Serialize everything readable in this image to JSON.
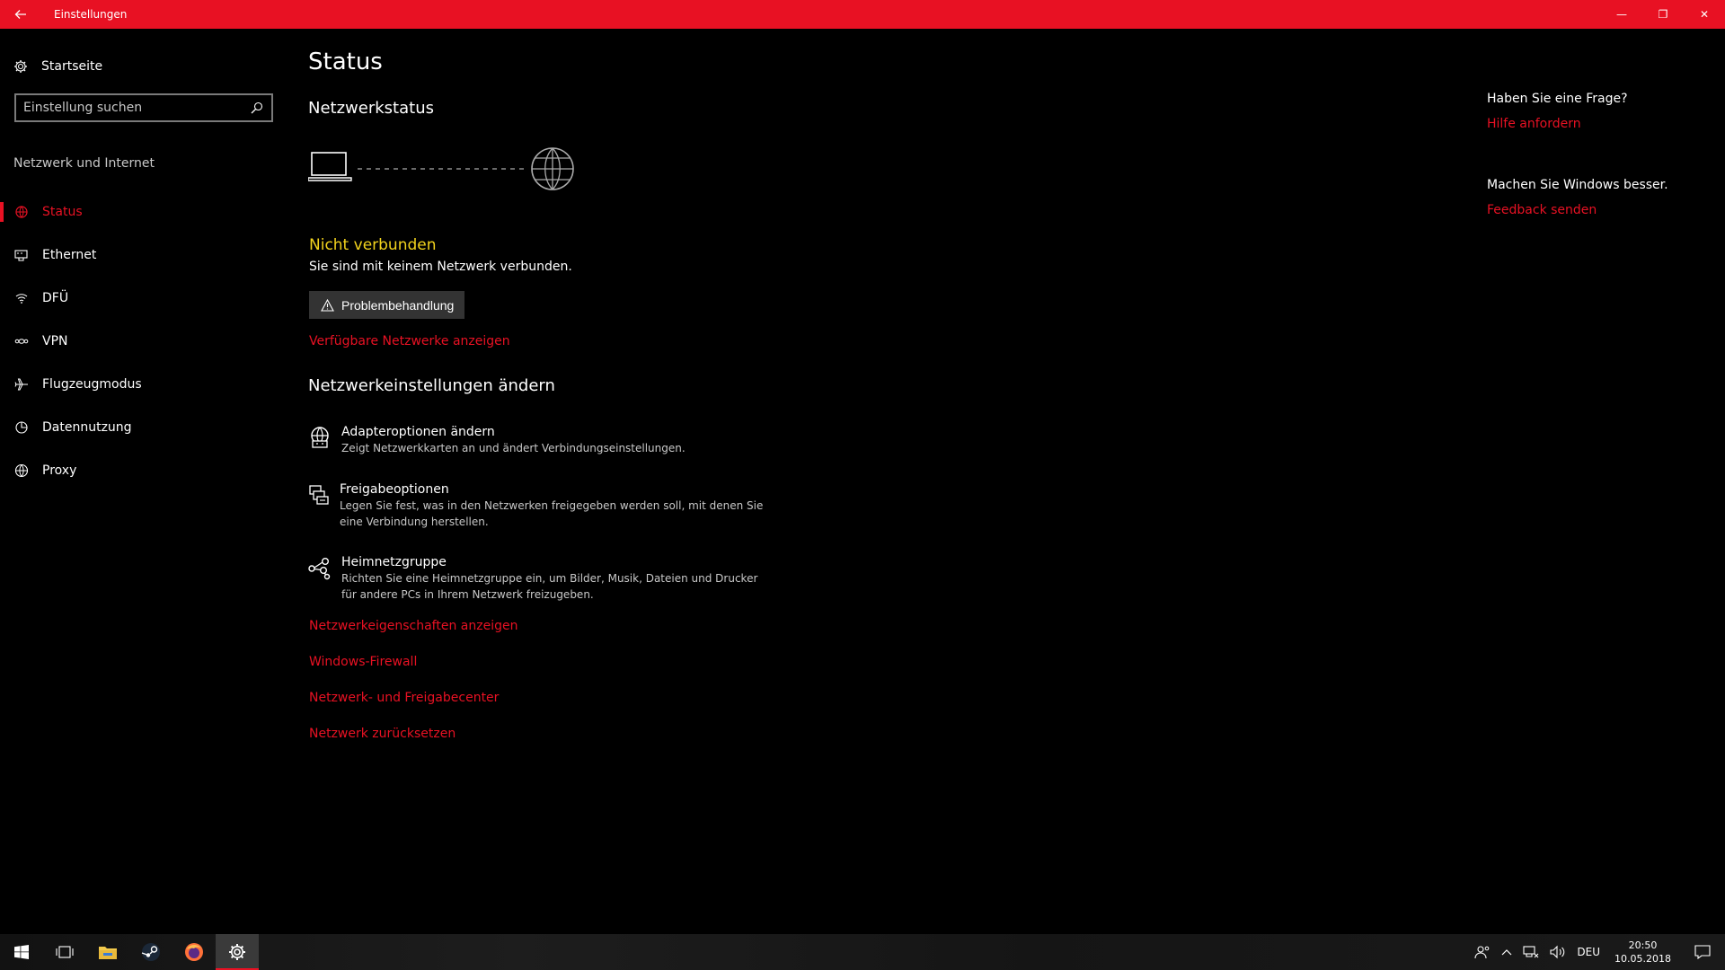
{
  "window": {
    "title": "Einstellungen",
    "back_icon": "back-arrow-icon",
    "controls": {
      "minimize": "—",
      "restore": "❐",
      "close": "✕"
    }
  },
  "sidebar": {
    "home_label": "Startseite",
    "search_placeholder": "Einstellung suchen",
    "section_label": "Netzwerk und Internet",
    "items": [
      {
        "label": "Status",
        "icon": "status-icon",
        "active": true
      },
      {
        "label": "Ethernet",
        "icon": "ethernet-icon",
        "active": false
      },
      {
        "label": "DFÜ",
        "icon": "dialup-icon",
        "active": false
      },
      {
        "label": "VPN",
        "icon": "vpn-icon",
        "active": false
      },
      {
        "label": "Flugzeugmodus",
        "icon": "airplane-icon",
        "active": false
      },
      {
        "label": "Datennutzung",
        "icon": "data-usage-icon",
        "active": false
      },
      {
        "label": "Proxy",
        "icon": "globe-icon",
        "active": false
      }
    ]
  },
  "main": {
    "title": "Status",
    "network_status_heading": "Netzwerkstatus",
    "status": {
      "title": "Nicht verbunden",
      "description": "Sie sind mit keinem Netzwerk verbunden.",
      "troubleshoot_button": "Problembehandlung",
      "available_networks_link": "Verfügbare Netzwerke anzeigen"
    },
    "change_heading": "Netzwerkeinstellungen ändern",
    "options": [
      {
        "title": "Adapteroptionen ändern",
        "desc": "Zeigt Netzwerkkarten an und ändert Verbindungseinstellungen.",
        "icon": "adapter-icon"
      },
      {
        "title": "Freigabeoptionen",
        "desc": "Legen Sie fest, was in den Netzwerken freigegeben werden soll, mit denen Sie eine Verbindung herstellen.",
        "icon": "sharing-icon"
      },
      {
        "title": "Heimnetzgruppe",
        "desc": "Richten Sie eine Heimnetzgruppe ein, um Bilder, Musik, Dateien und Drucker für andere PCs in Ihrem Netzwerk freizugeben.",
        "icon": "homegroup-icon"
      }
    ],
    "links": [
      "Netzwerkeigenschaften anzeigen",
      "Windows-Firewall",
      "Netzwerk- und Freigabecenter",
      "Netzwerk zurücksetzen"
    ]
  },
  "right_panel": {
    "question": "Haben Sie eine Frage?",
    "help_link": "Hilfe anfordern",
    "improve": "Machen Sie Windows besser.",
    "feedback_link": "Feedback senden"
  },
  "taskbar": {
    "language": "DEU",
    "time": "20:50",
    "date": "10.05.2018"
  },
  "colors": {
    "accent": "#e81123",
    "warning": "#f2d31d",
    "background": "#000000"
  }
}
